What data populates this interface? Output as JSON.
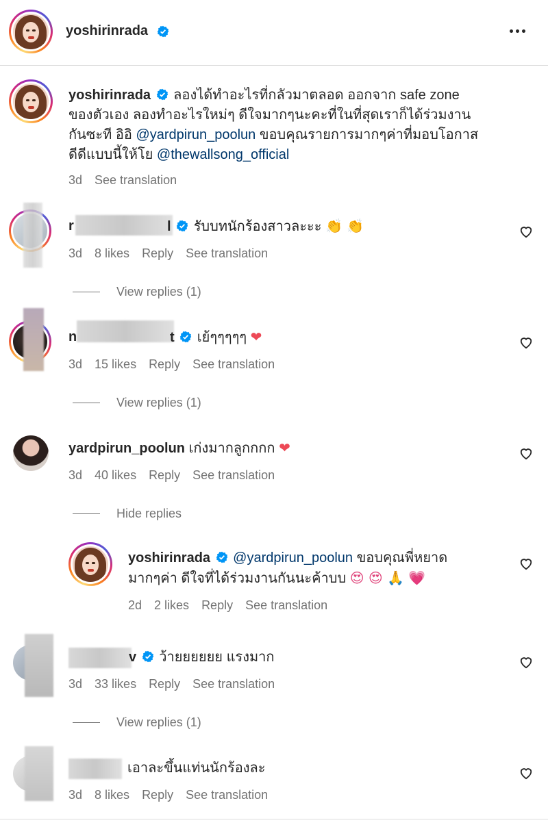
{
  "header": {
    "username": "yoshirinrada",
    "more_icon": "more-horizontal-icon"
  },
  "caption": {
    "username": "yoshirinrada",
    "text_part1": "ลองได้ทำอะไรที่กลัวมาตลอด ออกจาก safe zone",
    "text_part2": "ของตัวเอง ลองทำอะไรใหม่ๆ ดีใจมากๆนะคะที่ในที่สุดเราก็ได้ร่วมงาน",
    "text_part3a": "กันซะที อิอิ ",
    "mention1": "@yardpirun_poolun",
    "text_part3b": " ขอบคุณรายการมากๆค่าที่มอบโอกาส",
    "text_part4a": "ดีดีแบบนี้ให้โย ",
    "mention2": "@thewallsong_official",
    "time": "3d",
    "see_translation": "See translation"
  },
  "comments": [
    {
      "username_visible": "r",
      "username_tail": "l",
      "text": "รับบทนักร้องสาวละะะ",
      "emoji": "👏 👏",
      "time": "3d",
      "likes": "8 likes",
      "reply": "Reply",
      "see_translation": "See translation",
      "view_replies": "View replies (1)"
    },
    {
      "username_visible": "n",
      "username_tail": "t",
      "text": "เย้ๆๆๆๆๆ",
      "emoji": "❤",
      "time": "3d",
      "likes": "15 likes",
      "reply": "Reply",
      "see_translation": "See translation",
      "view_replies": "View replies (1)"
    },
    {
      "username": "yardpirun_poolun",
      "text": "เก่งมากลูกกกก",
      "emoji": "❤",
      "time": "3d",
      "likes": "40 likes",
      "reply": "Reply",
      "see_translation": "See translation",
      "hide_replies": "Hide replies"
    },
    {
      "username_tail": "v",
      "text": "ว้ายยยยยย แรงมาก",
      "time": "3d",
      "likes": "33 likes",
      "reply": "Reply",
      "see_translation": "See translation",
      "view_replies": "View replies (1)"
    },
    {
      "text": "เอาละขึ้นแท่นนักร้องละ",
      "time": "3d",
      "likes": "8 likes",
      "reply": "Reply",
      "see_translation": "See translation"
    }
  ],
  "reply": {
    "username": "yoshirinrada",
    "mention": "@yardpirun_poolun",
    "text1": " ขอบคุณพี่หยาด",
    "text2": "มากๆค่า ดีใจที่ได้ร่วมงานกันนะค้าบบ",
    "emoji": "😍 😍 🙏 💗",
    "time": "2d",
    "likes": "2 likes",
    "reply": "Reply",
    "see_translation": "See translation"
  },
  "colors": {
    "verified": "#0095f6",
    "mention": "#00376b",
    "meta": "#737373",
    "heart_red": "#ed4956"
  }
}
